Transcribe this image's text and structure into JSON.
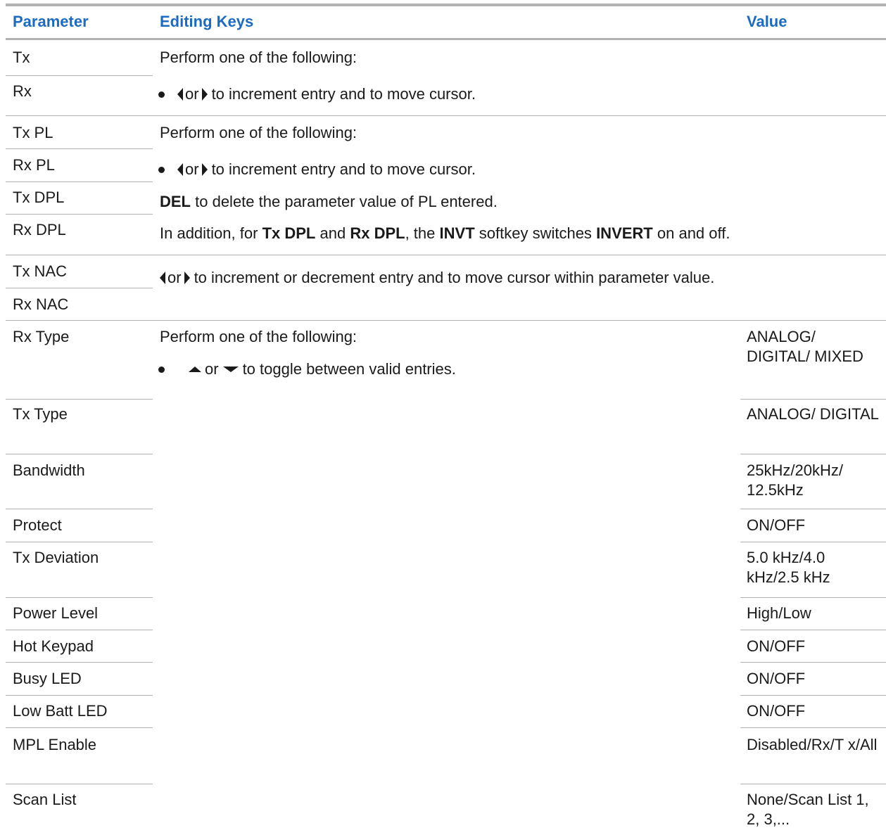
{
  "headers": {
    "parameter": "Parameter",
    "editing_keys": "Editing Keys",
    "value": "Value"
  },
  "icons": {
    "left_arrow": "left-triangle-icon",
    "right_arrow": "right-triangle-icon",
    "up_arrow": "up-chevron-icon",
    "down_arrow": "down-chevron-icon"
  },
  "group1": {
    "params": [
      "Tx",
      "Rx"
    ],
    "intro": "Perform one of the following:",
    "bullet_or": "or",
    "bullet_text": "to increment entry and to move cursor."
  },
  "group2": {
    "params": [
      "Tx PL",
      "Rx PL",
      "Tx DPL",
      "Rx DPL"
    ],
    "intro": "Perform one of the following:",
    "bullet_or": "or",
    "bullet_text": "to increment entry and to move cursor.",
    "del_key": "DEL",
    "del_text": "to delete the parameter value of PL entered.",
    "add_1": "In addition, for",
    "add_tx_dpl": "Tx DPL",
    "add_and": "and",
    "add_rx_dpl": "Rx DPL",
    "add_2": ", the",
    "add_invt": "INVT",
    "add_3": "softkey switches",
    "add_invert": "INVERT",
    "add_4": "on and off."
  },
  "group3": {
    "params": [
      "Tx NAC",
      "Rx NAC"
    ],
    "or": "or",
    "text": "to increment or decrement entry and to move cursor within parameter value."
  },
  "group4": {
    "intro": "Perform one of the following:",
    "bullet_or": "or",
    "bullet_text": "to toggle between valid entries.",
    "rows": [
      {
        "param": "Rx Type",
        "value": "ANALOG/ DIGITAL/ MIXED"
      },
      {
        "param": "Tx Type",
        "value": "ANALOG/ DIGITAL"
      },
      {
        "param": "Bandwidth",
        "value": "25kHz/20kHz/ 12.5kHz"
      },
      {
        "param": "Protect",
        "value": "ON/OFF"
      },
      {
        "param": "Tx Deviation",
        "value": "5.0 kHz/4.0 kHz/2.5 kHz"
      },
      {
        "param": "Power Level",
        "value": "High/Low"
      },
      {
        "param": "Hot Keypad",
        "value": "ON/OFF"
      },
      {
        "param": "Busy LED",
        "value": "ON/OFF"
      },
      {
        "param": "Low Batt LED",
        "value": "ON/OFF"
      },
      {
        "param": "MPL Enable",
        "value": "Disabled/Rx/T x/All"
      },
      {
        "param": "Scan List",
        "value": "None/Scan List 1, 2, 3,..."
      }
    ]
  }
}
